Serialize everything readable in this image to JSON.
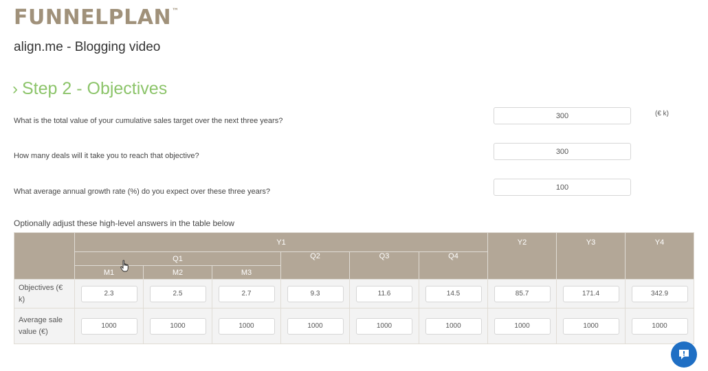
{
  "brand": {
    "name": "FUNNELPLAN",
    "tm": "™"
  },
  "project": {
    "title": "align.me - Blogging video"
  },
  "step": {
    "chevron": "›",
    "title": "Step 2 - Objectives"
  },
  "questions": [
    {
      "label": "What is the total value of your cumulative sales target over the next three years?",
      "value": "300",
      "unit": "(€ k)"
    },
    {
      "label": "How many deals will it take you to reach that objective?",
      "value": "300"
    },
    {
      "label": "What average annual growth rate (%) do you expect over these three years?",
      "value": "100"
    }
  ],
  "table": {
    "caption": "Optionally adjust these high-level answers in the table below",
    "y1": "Y1",
    "q1": "Q1",
    "months": [
      "M1",
      "M2",
      "M3"
    ],
    "quarters": [
      "Q2",
      "Q3",
      "Q4"
    ],
    "years": [
      "Y2",
      "Y3",
      "Y4"
    ],
    "rows": [
      {
        "label": "Objectives (€ k)",
        "values": [
          "2.3",
          "2.5",
          "2.7",
          "9.3",
          "11.6",
          "14.5",
          "85.7",
          "171.4",
          "342.9"
        ]
      },
      {
        "label": "Average sale value (€)",
        "values": [
          "1000",
          "1000",
          "1000",
          "1000",
          "1000",
          "1000",
          "1000",
          "1000",
          "1000"
        ]
      }
    ]
  },
  "colors": {
    "brand": "#a0917a",
    "accent": "#8cc46a",
    "header": "#b3a797",
    "chat": "#1f6fc4"
  },
  "icons": {
    "chat": "chat-bubble-icon",
    "cursor": "hand-cursor-icon"
  }
}
